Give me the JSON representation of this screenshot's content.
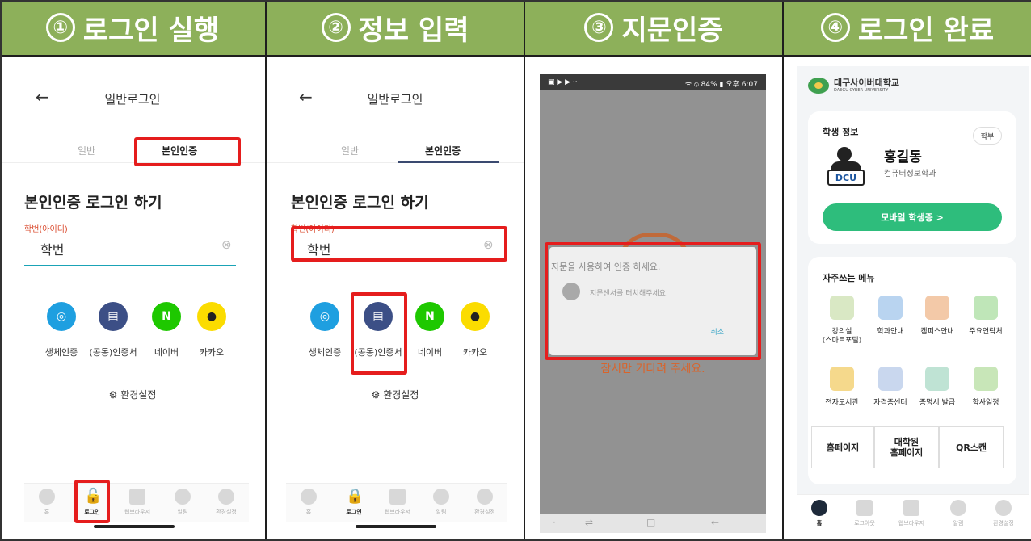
{
  "steps": [
    {
      "num": "①",
      "label": "로그인 실행"
    },
    {
      "num": "②",
      "label": "정보 입력"
    },
    {
      "num": "③",
      "label": "지문인증"
    },
    {
      "num": "④",
      "label": "로그인 완료"
    }
  ],
  "login": {
    "back_icon": "←",
    "title": "일반로그인",
    "tab_general": "일반",
    "tab_identity": "본인인증",
    "heading": "본인인증 로그인 하기",
    "field_label": "학번(아이디)",
    "field_value": "학번",
    "clear_icon": "⊗",
    "options": [
      {
        "label": "생체인증",
        "glyph": "◎",
        "color": "#1e9fe0"
      },
      {
        "label": "(공동)인증서",
        "glyph": "▤",
        "color": "#3c4f86"
      },
      {
        "label": "네이버",
        "glyph": "N",
        "color": "#1ec800"
      },
      {
        "label": "카카오",
        "glyph": "●",
        "color": "#fbdc00"
      }
    ],
    "settings": "환경설정",
    "settings_icon": "⚙",
    "nav": [
      {
        "label": "홈"
      },
      {
        "label": "로그인"
      },
      {
        "label": "웹브라우저"
      },
      {
        "label": "알림"
      },
      {
        "label": "환경설정"
      }
    ]
  },
  "fingerprint": {
    "status_left": "▣ ▶ ▶ ··",
    "status_right": "ᯤ ⦸ 84% ▮ 오후 6:07",
    "dialog_title": "지문을 사용하여 인증 하세요.",
    "dialog_msg": "지문센서를 터치해주세요.",
    "cancel": "취소",
    "wait_text": "잠시만 기다려 주세요.",
    "android_nav": [
      "·",
      "⇌",
      "□",
      "←"
    ]
  },
  "app": {
    "logo_ko": "대구사이버대학교",
    "logo_en": "DAEGU CYBER UNIVERSITY",
    "student_info_title": "학생 정보",
    "badge": "학부",
    "avatar_text": "DCU",
    "name": "홍길동",
    "dept": "컴퓨터정보학과",
    "mobile_id": "모바일 학생증 >",
    "menu_title": "자주쓰는 메뉴",
    "menu": [
      {
        "label": "강의실\n(스마트포털)",
        "color": "#d9e8c4"
      },
      {
        "label": "학과안내",
        "color": "#b9d4f0"
      },
      {
        "label": "캠퍼스안내",
        "color": "#f3c9a8"
      },
      {
        "label": "주요연락처",
        "color": "#bfe6b8"
      },
      {
        "label": "전자도서관",
        "color": "#f5d98c"
      },
      {
        "label": "자격증센터",
        "color": "#c9d7ee"
      },
      {
        "label": "증명서 발급",
        "color": "#bfe3d4"
      },
      {
        "label": "학사일정",
        "color": "#c8e6b8"
      }
    ],
    "links": [
      "홈페이지",
      "대학원\n홈페이지",
      "QR스캔"
    ],
    "nav": [
      {
        "label": "홈"
      },
      {
        "label": "로그아웃"
      },
      {
        "label": "웹브라우저"
      },
      {
        "label": "알림"
      },
      {
        "label": "환경설정"
      }
    ]
  }
}
